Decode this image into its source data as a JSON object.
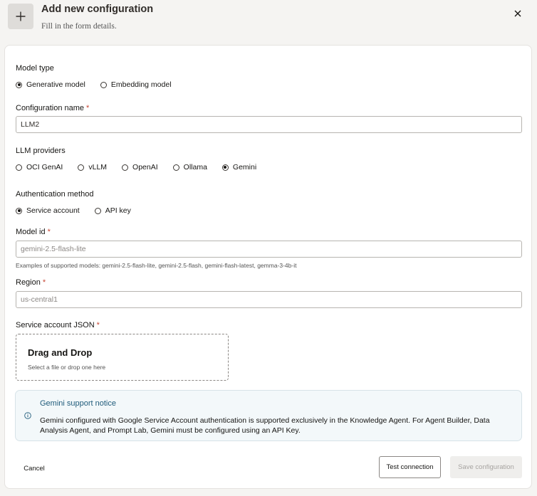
{
  "dialog": {
    "title": "Add new configuration",
    "subtitle": "Fill in the form details.",
    "plus_icon": "plus-icon",
    "close_icon": "close-icon"
  },
  "model_type": {
    "label": "Model type",
    "options": [
      {
        "label": "Generative model",
        "selected": true
      },
      {
        "label": "Embedding model",
        "selected": false
      }
    ]
  },
  "configuration_name": {
    "label": "Configuration name",
    "required_mark": "*",
    "value": "LLM2"
  },
  "llm_providers": {
    "label": "LLM providers",
    "options": [
      {
        "label": "OCI GenAI",
        "selected": false
      },
      {
        "label": "vLLM",
        "selected": false
      },
      {
        "label": "OpenAI",
        "selected": false
      },
      {
        "label": "Ollama",
        "selected": false
      },
      {
        "label": "Gemini",
        "selected": true
      }
    ]
  },
  "auth_method": {
    "label": "Authentication method",
    "options": [
      {
        "label": "Service account",
        "selected": true
      },
      {
        "label": "API key",
        "selected": false
      }
    ]
  },
  "model_id": {
    "label": "Model id",
    "required_mark": "*",
    "placeholder": "gemini-2.5-flash-lite",
    "hint": "Examples of supported models: gemini-2.5-flash-lite, gemini-2.5-flash, gemini-flash-latest, gemma-3-4b-it"
  },
  "region": {
    "label": "Region",
    "required_mark": "*",
    "placeholder": "us-central1"
  },
  "service_account": {
    "label": "Service account JSON",
    "required_mark": "*",
    "dropzone_title": "Drag and Drop",
    "dropzone_subtitle": "Select a file or drop one here"
  },
  "notice": {
    "icon": "info-icon",
    "title": "Gemini support notice",
    "body": "Gemini configured with Google Service Account authentication is supported exclusively in the Knowledge Agent. For Agent Builder, Data Analysis Agent, and Prompt Lab, Gemini must be configured using an API Key."
  },
  "footer": {
    "cancel": "Cancel",
    "test_connection": "Test connection",
    "save_configuration": "Save configuration"
  },
  "colors": {
    "required": "#c74634",
    "notice_title": "#1f5b7a",
    "notice_bg": "#f3f8fa"
  }
}
